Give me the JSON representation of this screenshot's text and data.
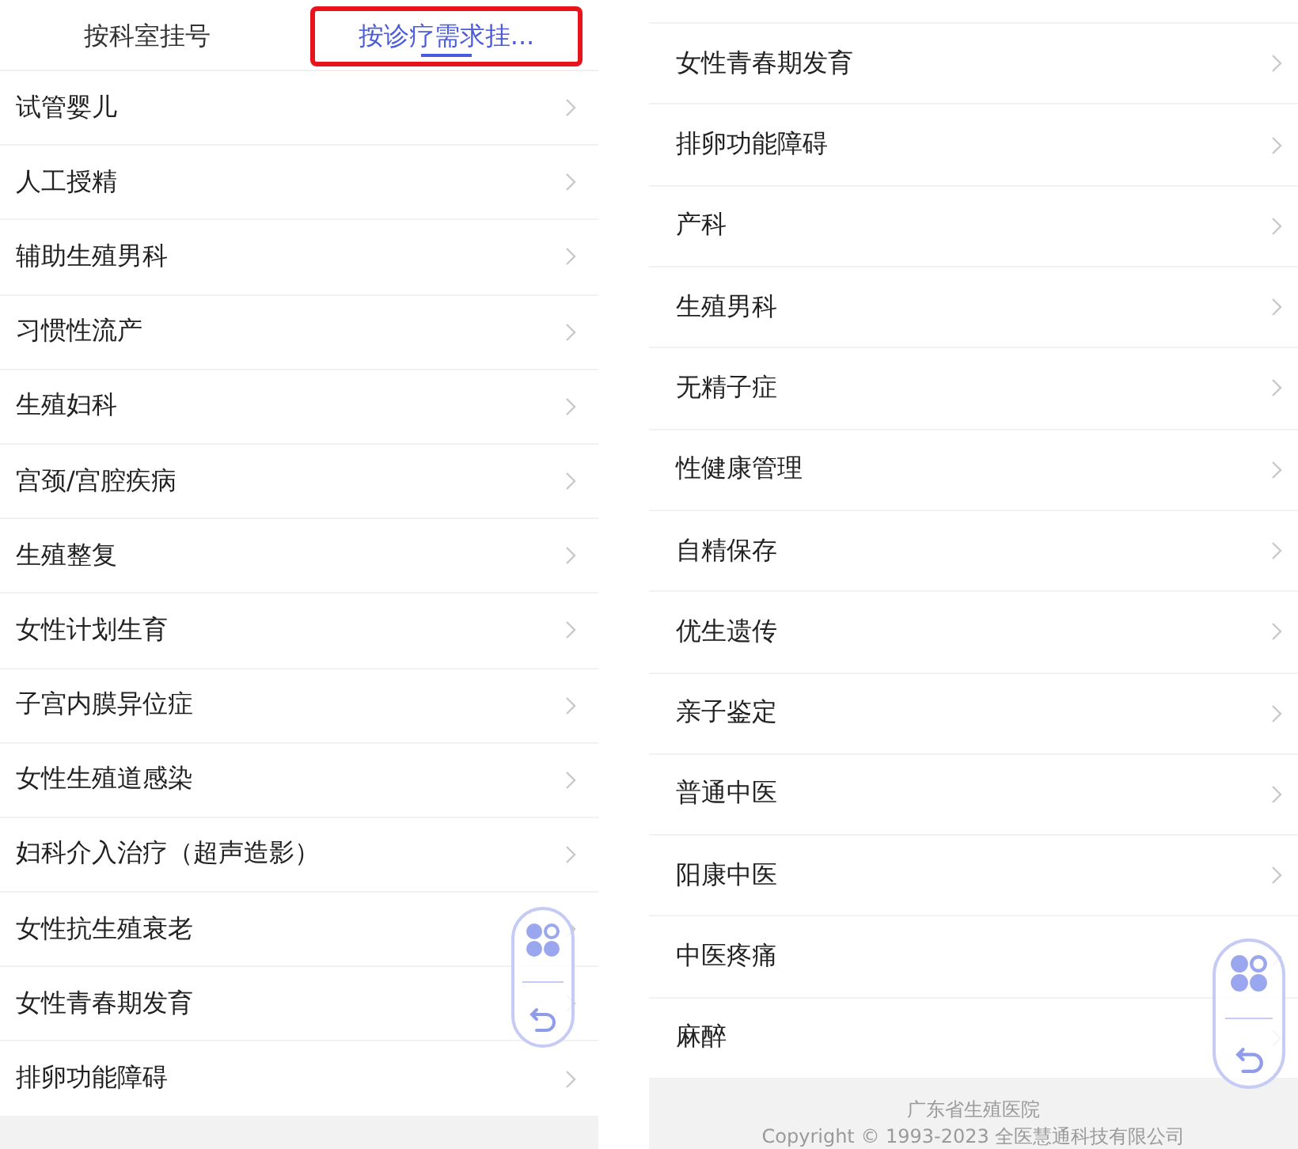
{
  "left_panel": {
    "tabs": [
      {
        "label": "按科室挂号",
        "selected": false,
        "highlighted": false
      },
      {
        "label": "按诊疗需求挂...",
        "selected": true,
        "highlighted": true
      }
    ],
    "items": [
      "试管婴儿",
      "人工授精",
      "辅助生殖男科",
      "习惯性流产",
      "生殖妇科",
      "宫颈/宫腔疾病",
      "生殖整复",
      "女性计划生育",
      "子宫内膜异位症",
      "女性生殖道感染",
      "妇科介入治疗（超声造影）",
      "女性抗生殖衰老",
      "女性青春期发育",
      "排卵功能障碍"
    ]
  },
  "right_panel": {
    "items": [
      "女性青春期发育",
      "排卵功能障碍",
      "产科",
      "生殖男科",
      "无精子症",
      "性健康管理",
      "自精保存",
      "优生遗传",
      "亲子鉴定",
      "普通中医",
      "阳康中医",
      "中医疼痛",
      "麻醉"
    ],
    "footer": {
      "hospital": "广东省生殖医院",
      "copyright": "Copyright © 1993-2023 全医慧通科技有限公司"
    }
  }
}
